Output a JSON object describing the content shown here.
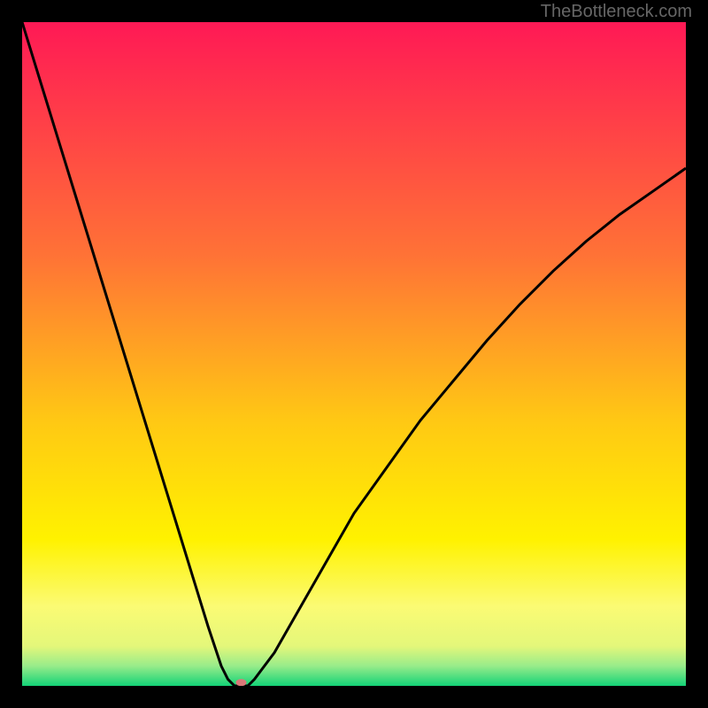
{
  "watermark": "TheBottleneck.com",
  "chart_data": {
    "type": "line",
    "title": "",
    "xlabel": "",
    "ylabel": "",
    "x_range": [
      0,
      100
    ],
    "y_range": [
      0,
      100
    ],
    "background_gradient": {
      "stops": [
        {
          "offset": 0,
          "color": "#ff1955"
        },
        {
          "offset": 0.35,
          "color": "#ff7236"
        },
        {
          "offset": 0.6,
          "color": "#ffc814"
        },
        {
          "offset": 0.78,
          "color": "#fff200"
        },
        {
          "offset": 0.88,
          "color": "#fbfb74"
        },
        {
          "offset": 0.94,
          "color": "#e4f77a"
        },
        {
          "offset": 0.97,
          "color": "#98ec8a"
        },
        {
          "offset": 1.0,
          "color": "#13d377"
        }
      ]
    },
    "series": [
      {
        "name": "bottleneck-curve",
        "color": "#000000",
        "x": [
          0,
          2,
          4,
          6,
          8,
          10,
          12,
          14,
          16,
          18,
          20,
          22,
          24,
          26,
          28,
          30,
          31,
          32,
          33,
          34,
          35,
          38,
          42,
          46,
          50,
          55,
          60,
          65,
          70,
          75,
          80,
          85,
          90,
          95,
          100
        ],
        "y": [
          100,
          93.5,
          87,
          80.5,
          74,
          67.5,
          61,
          54.5,
          48,
          41.5,
          35,
          28.5,
          22,
          15.5,
          9,
          3,
          1,
          0,
          0,
          0,
          1,
          5,
          12,
          19,
          26,
          33,
          40,
          46,
          52,
          57.5,
          62.5,
          67,
          71,
          74.5,
          78
        ]
      }
    ],
    "marker": {
      "x": 33,
      "y": 0.5,
      "rx": 6,
      "ry": 4,
      "color": "#d97878"
    }
  }
}
